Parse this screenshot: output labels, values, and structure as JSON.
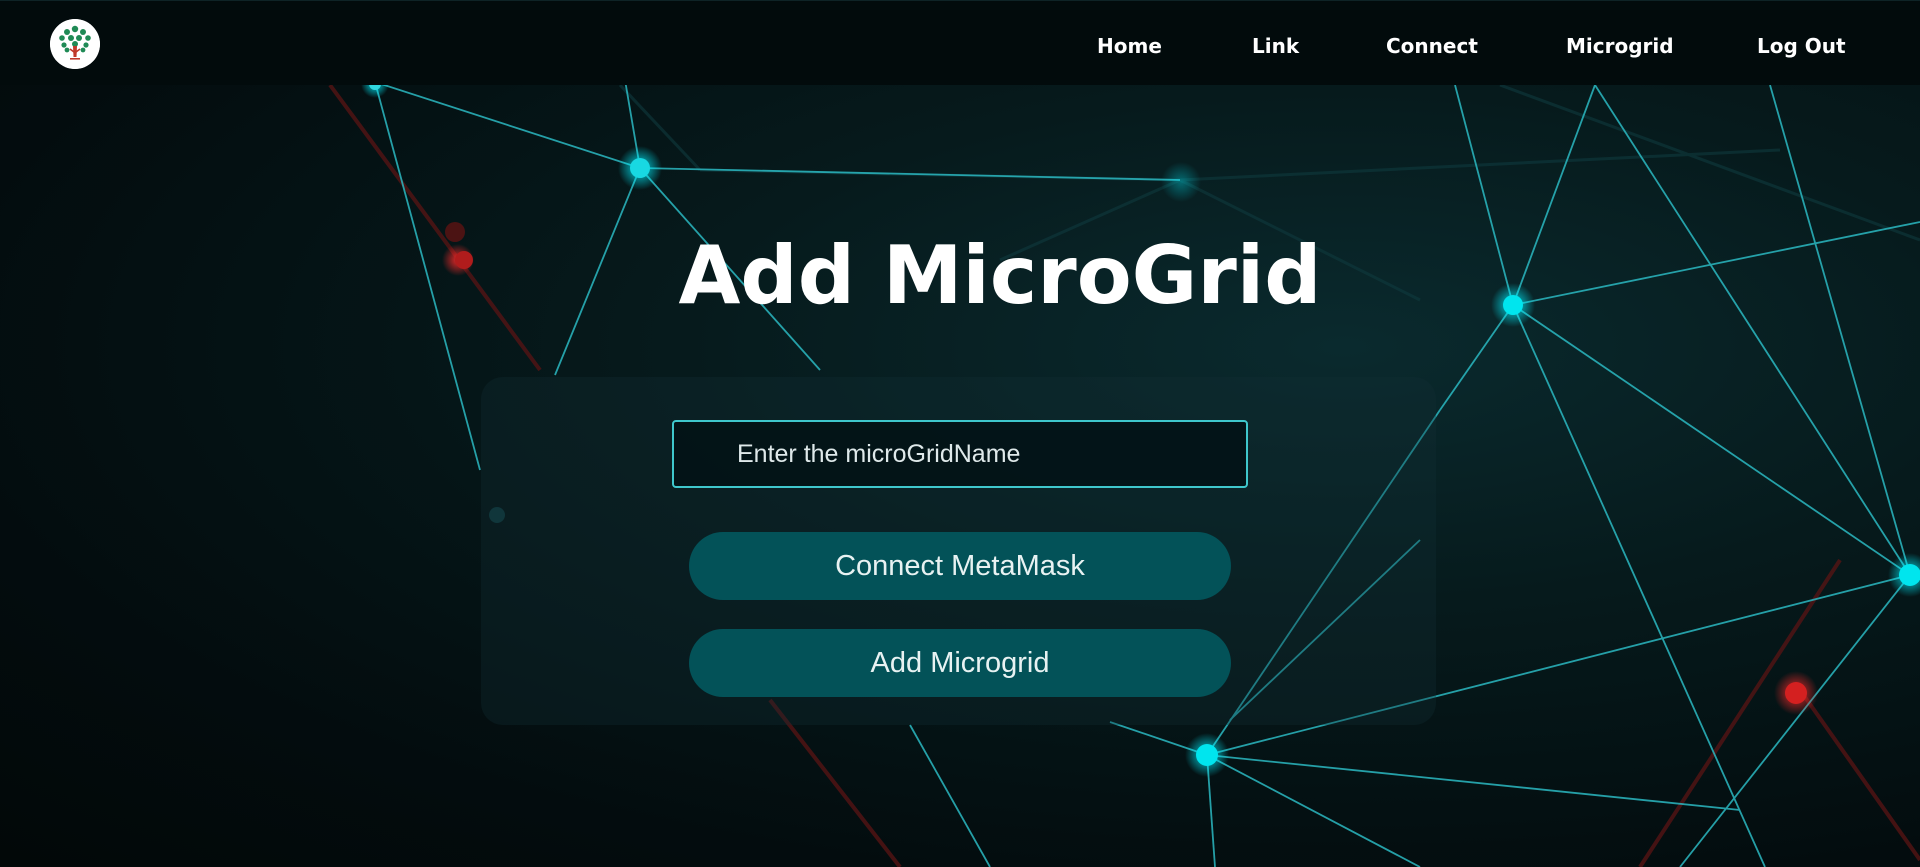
{
  "navbar": {
    "logo": "tree-logo",
    "links": [
      "Home",
      "Link",
      "Connect",
      "Microgrid",
      "Log Out"
    ]
  },
  "main": {
    "title": "Add MicroGrid",
    "input": {
      "placeholder": "Enter the microGridName",
      "value": ""
    },
    "buttons": {
      "connect_label": "Connect MetaMask",
      "add_label": "Add Microgrid"
    }
  },
  "colors": {
    "background": "#041214",
    "navbar": "#020b0c",
    "accent_cyan": "#3fc7cc",
    "node_cyan": "#00e5ee",
    "node_red": "#e02020",
    "button_bg": "#035258",
    "text": "#ffffff"
  }
}
